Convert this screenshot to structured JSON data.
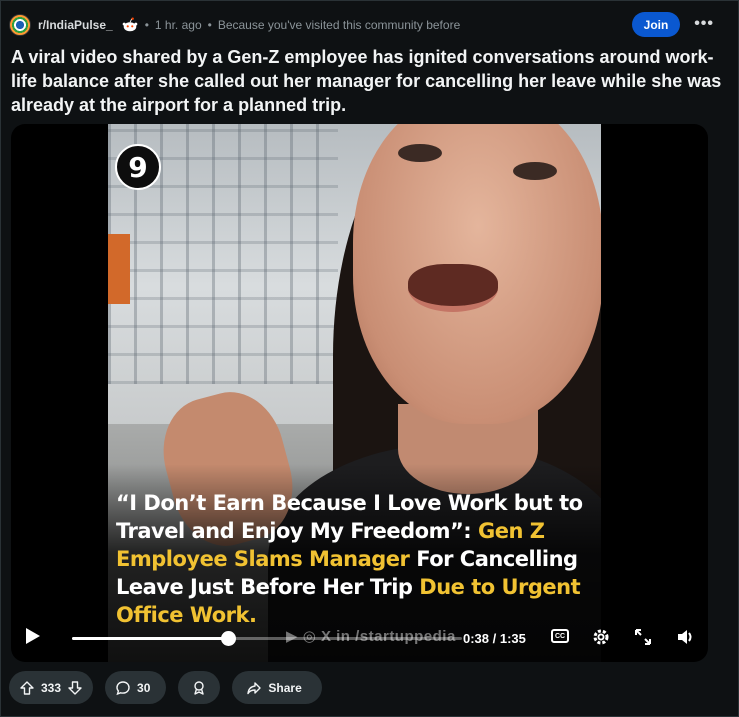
{
  "post": {
    "subreddit": "r/IndiaPulse_",
    "age": "1 hr. ago",
    "reason": "Because you've visited this community before",
    "join_label": "Join",
    "more_label": "•••",
    "title": "A viral video shared by a Gen-Z employee has ignited conversations around work-life balance after she called out her manager for cancelling her leave while she was already at the airport for a planned trip."
  },
  "video": {
    "logo_letter": "9",
    "caption": [
      [
        {
          "t": "“I Don’t Earn Because I Love Work",
          "c": "w"
        },
        {
          "t": " but to",
          "c": "w"
        }
      ],
      [
        {
          "t": "Travel and Enjoy My Freedom”: ",
          "c": "w"
        },
        {
          "t": "Gen Z",
          "c": "y"
        }
      ],
      [
        {
          "t": "Employee Slams Manager",
          "c": "y"
        },
        {
          "t": " For Cancelling",
          "c": "w"
        }
      ],
      [
        {
          "t": "Leave Just Before Her Trip ",
          "c": "w"
        },
        {
          "t": "Due to Urgent",
          "c": "y"
        }
      ],
      [
        {
          "t": "Office Work.",
          "c": "y"
        }
      ]
    ],
    "watermark": "▶ ◎ X in /startuppedia",
    "current_time": "0:38",
    "duration": "1:35",
    "time_text": "0:38 / 1:35",
    "progress": 0.4,
    "cc_label": "CC"
  },
  "actions": {
    "upvotes": "333",
    "comments": "30",
    "share_label": "Share"
  },
  "colors": {
    "background": "#0e1113",
    "join_button": "#0a58d0",
    "pill": "#2a3236",
    "caption_highlight": "#f1c232"
  }
}
